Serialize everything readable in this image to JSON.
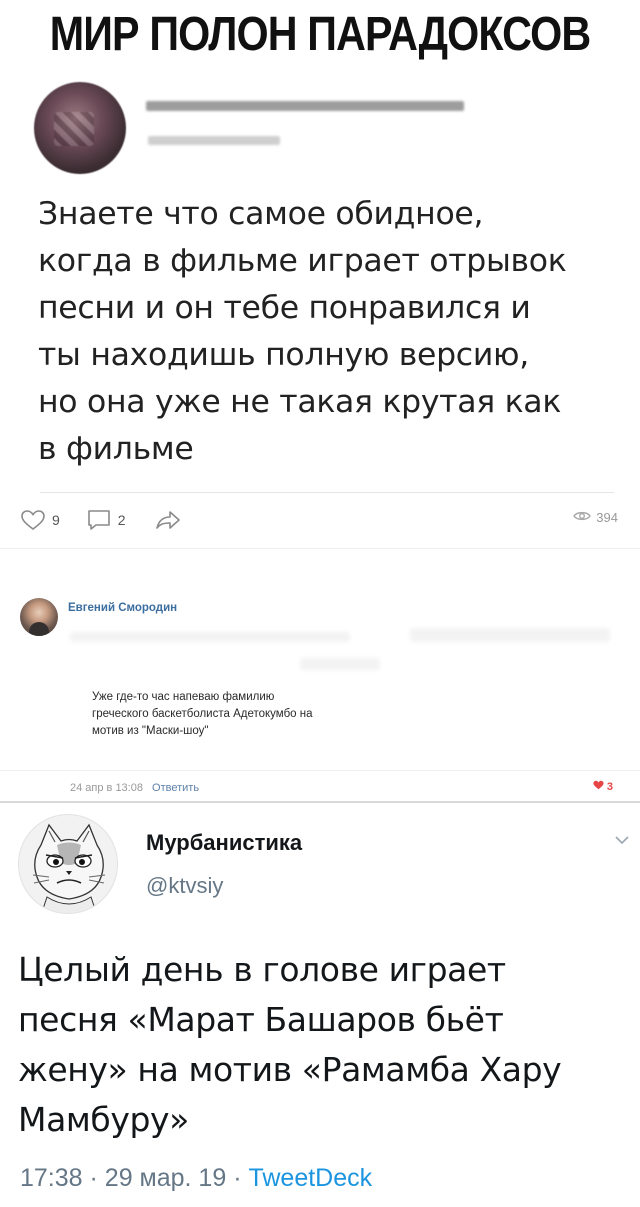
{
  "meme_title": "МИР ПОЛОН ПАРАДОКСОВ",
  "post1": {
    "text_lines": [
      "Знаете что самое обидное,",
      "когда в фильме играет отрывок",
      "песни и он тебе понравился и",
      "ты находишь полную версию,",
      "но она уже не такая крутая как",
      "в фильме"
    ],
    "likes": "9",
    "comments": "2",
    "views": "394"
  },
  "comment": {
    "author": "Евгений Смородин",
    "text_lines": [
      "Уже где-то час напеваю фамилию",
      "греческого баскетболиста Адетокумбо на",
      "мотив из \"Маски-шоу\""
    ],
    "timestamp": "24 апр в 13:08",
    "reply_label": "Ответить",
    "likes": "3"
  },
  "tweet": {
    "name": "Мурбанистика",
    "handle": "@ktvsiy",
    "text_lines": [
      "Целый день в голове играет",
      "песня «Марат Башаров бьёт",
      "жену» на мотив «Рамамба Хару",
      "Мамбуру»"
    ],
    "time": "17:38",
    "date": "29 мар. 19",
    "separator": "·",
    "source": "TweetDeck"
  },
  "colors": {
    "link_blue": "#3c6e9f",
    "like_red": "#e64646",
    "twitter_blue": "#1b95e0",
    "muted_gray": "#657786"
  }
}
